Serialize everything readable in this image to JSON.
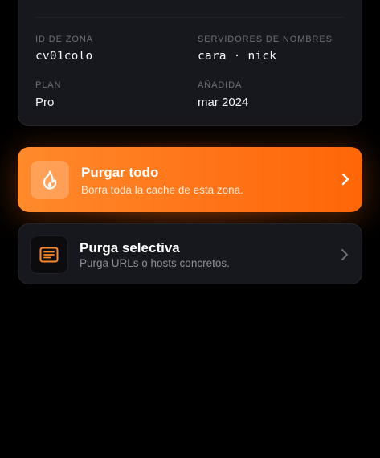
{
  "zone_info": {
    "zone_id_label": "ID DE ZONA",
    "zone_id_value": "cv01colo",
    "nameservers_label": "SERVIDORES DE NOMBRES",
    "nameservers_value": "cara · nick",
    "plan_label": "PLAN",
    "plan_value": "Pro",
    "added_label": "AÑADIDA",
    "added_value": "mar 2024"
  },
  "actions": {
    "purge_all": {
      "title": "Purgar todo",
      "subtitle": "Borra toda la cache de esta zona.",
      "icon": "flame-icon",
      "color": "#ff7418"
    },
    "purge_selective": {
      "title": "Purga selectiva",
      "subtitle": "Purga URLs o hosts concretos.",
      "icon": "list-icon",
      "color": "#ff8a2b"
    }
  }
}
